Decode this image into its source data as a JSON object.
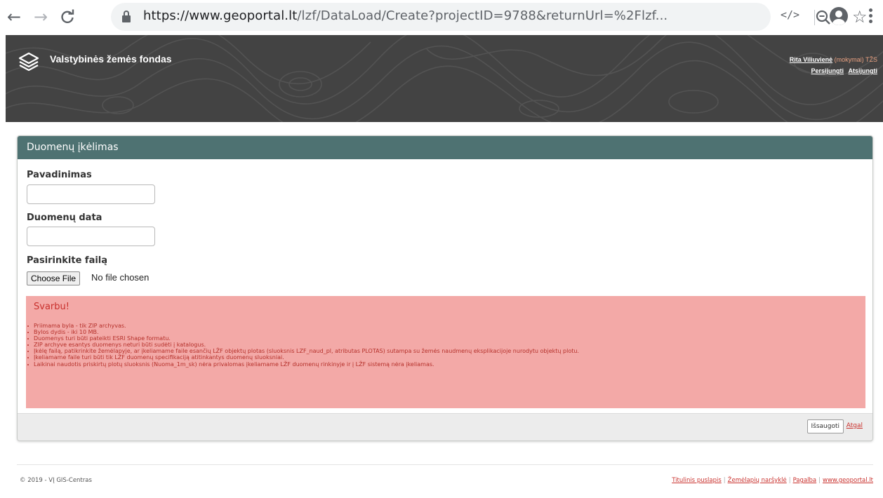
{
  "browser": {
    "url_host": "https://www.geoportal.lt",
    "url_path": "/lzf/DataLoad/Create?projectID=9788&returnUrl=%2Flzf...",
    "icons": [
      "back-arrow-icon",
      "forward-arrow-icon",
      "reload-icon",
      "lock-icon",
      "zoom-icon",
      "star-icon",
      "code-icon",
      "account-icon",
      "menu-icon"
    ]
  },
  "header": {
    "title": "Valstybinės žemės fondas",
    "user_name": "Rita Viliuvienė",
    "user_role": "(mokymai) TŽS",
    "reconnect_label": "Persijungti",
    "logout_label": "Atsijungti"
  },
  "form": {
    "heading": "Duomenų įkėlimas",
    "name_label": "Pavadinimas",
    "name_value": "",
    "date_label": "Duomenų data",
    "date_value": "",
    "file_label": "Pasirinkite failą",
    "choose_file_label": "Choose File",
    "no_file_text": "No file chosen"
  },
  "alert": {
    "title": "Svarbu!",
    "items": [
      "Priimama byla - tik ZIP archyvas.",
      "Bylos dydis - iki 10 MB.",
      "Duomenys turi būti pateikti ESRI Shape formatu.",
      "ZIP archyve esantys duomenys neturi būti sudėti į katalogus.",
      "Įkėlę failą, patikrinkite žemėlapyje, ar įkeliamame faile esančių LŽF objektų plotas (sluoksnis LZF_naud_pl, atributas PLOTAS) sutampa su žemės naudmenų eksplikacijoje nurodytu objektų plotu.",
      "Įkeliamame faile turi būti tik LŽF duomenų specifikaciją atitinkantys duomenų sluoksniai.",
      "Laikinai naudotis priskirtų plotų sluoksnis (Nuoma_1m_sk) nėra privalomas įkeliamame LŽF duomenų rinkinyje ir į LŽF sistemą nėra įkeliamas."
    ]
  },
  "actions": {
    "save_label": "Išsaugoti",
    "back_label": "Atgal"
  },
  "footer": {
    "copyright": "© 2019 - VĮ GIS-Centras",
    "links": [
      "Titulinis puslapis",
      "Žemėlapių naršyklė",
      "Pagalba",
      "www.geoportal.lt"
    ]
  },
  "colors": {
    "panel_header": "#4e7272",
    "alert_bg": "#f3a9a7",
    "alert_text": "#c9302c",
    "site_header": "#434343"
  }
}
